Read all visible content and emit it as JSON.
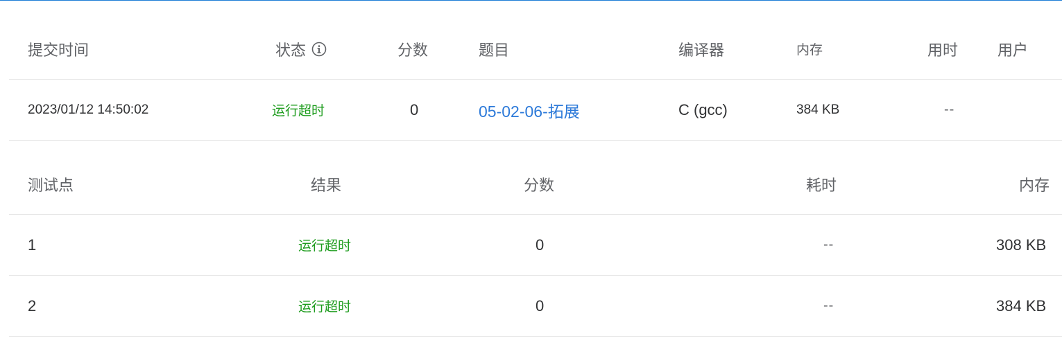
{
  "submission_table": {
    "headers": {
      "submit_time": "提交时间",
      "status": "状态",
      "score": "分数",
      "problem": "题目",
      "compiler": "编译器",
      "memory": "内存",
      "time_used": "用时",
      "user": "用户"
    },
    "row": {
      "submit_time": "2023/01/12 14:50:02",
      "status": "运行超时",
      "score": "0",
      "problem": "05-02-06-拓展",
      "compiler": "C (gcc)",
      "memory": "384 KB",
      "time_used": "--",
      "user": ""
    }
  },
  "testcase_table": {
    "headers": {
      "testcase": "测试点",
      "result": "结果",
      "score": "分数",
      "time": "耗时",
      "memory": "内存"
    },
    "rows": [
      {
        "testcase": "1",
        "result": "运行超时",
        "score": "0",
        "time": "--",
        "memory": "308 KB"
      },
      {
        "testcase": "2",
        "result": "运行超时",
        "score": "0",
        "time": "--",
        "memory": "384 KB"
      }
    ]
  },
  "icons": {
    "status_info": "info-circle-icon"
  },
  "colors": {
    "accent_line": "#1f7ed6",
    "status_timeout": "#1e9c1e",
    "link": "#2d7ad9",
    "divider": "#e6e6e6"
  }
}
